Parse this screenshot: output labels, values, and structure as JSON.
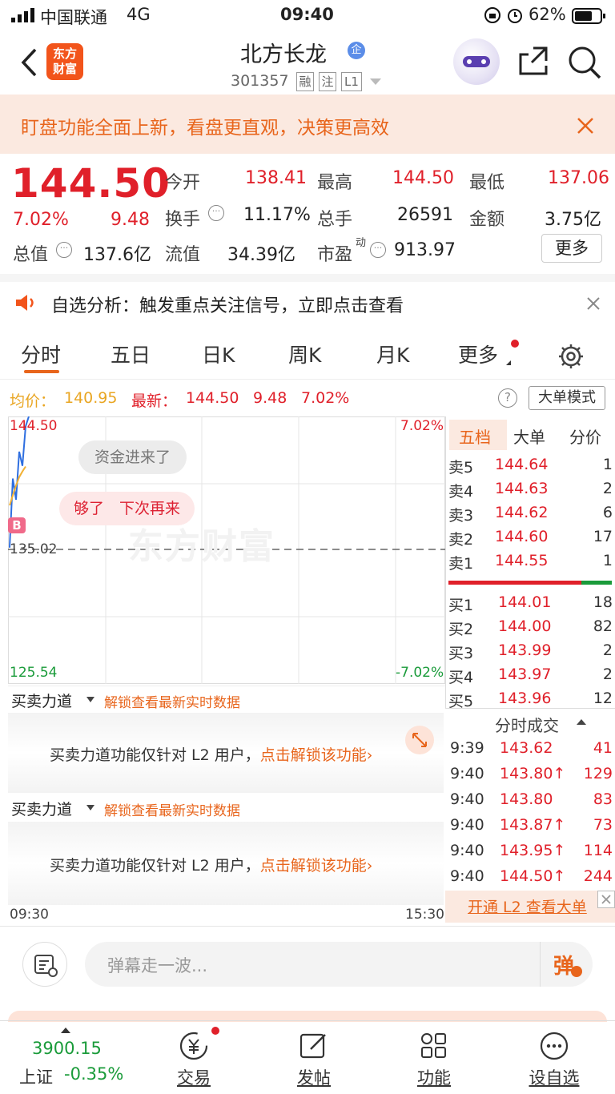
{
  "status_bar": {
    "carrier": "中国联通",
    "network": "4G",
    "time": "09:40",
    "battery": "62%"
  },
  "header": {
    "stock_name": "北方长龙",
    "badge": "企",
    "stock_code": "301357",
    "tags": [
      "融",
      "注",
      "L1"
    ],
    "logo_text": "东方财富"
  },
  "banner": {
    "text": "盯盘功能全面上新，看盘更直观，决策更高效"
  },
  "quote": {
    "price": "144.50",
    "change_pct": "7.02%",
    "change": "9.48",
    "open_label": "今开",
    "open": "138.41",
    "high_label": "最高",
    "high": "144.50",
    "low_label": "最低",
    "low": "137.06",
    "turnover_label": "换手",
    "turnover": "11.17%",
    "volume_label": "总手",
    "volume": "26591",
    "amount_label": "金额",
    "amount": "3.75亿",
    "mktcap_label": "总值",
    "mktcap": "137.6亿",
    "float_label": "流值",
    "float": "34.39亿",
    "pe_label": "市盈",
    "pe_sup": "动",
    "pe": "913.97",
    "more_button": "更多"
  },
  "alert": {
    "text": "自选分析：触发重点关注信号，立即点击查看"
  },
  "tabs": [
    "分时",
    "五日",
    "日K",
    "周K",
    "月K",
    "更多"
  ],
  "active_tab": "分时",
  "chart_info": {
    "avg_label": "均价：",
    "avg": "140.95",
    "latest_label": "最新：",
    "latest": "144.50",
    "change": "9.48",
    "change_pct": "7.02%",
    "mode_button": "大单模式"
  },
  "chart": {
    "top_price": "144.50",
    "top_pct": "7.02%",
    "mid_price": "135.02",
    "bottom_price": "125.54",
    "bottom_pct": "-7.02%",
    "start_time": "09:30",
    "end_time": "15:30",
    "bubble1": "资金进来了",
    "bubble2": "够了　下次再来",
    "watermark": "东方财富",
    "b_marker": "B"
  },
  "chart_data": {
    "type": "line",
    "title": "",
    "ylim": [
      125.54,
      144.5
    ],
    "series": [
      {
        "name": "",
        "values": [
          135.2,
          140.1,
          138.6,
          142.0,
          141.0,
          143.8,
          144.5
        ]
      },
      {
        "name": "",
        "values": [
          138.2,
          138.9,
          139.6,
          140.2,
          140.6,
          140.95
        ]
      }
    ]
  },
  "orderbook": {
    "tabs": [
      "五档",
      "大单",
      "分价"
    ],
    "asks": [
      {
        "label": "卖5",
        "price": "144.64",
        "vol": "1"
      },
      {
        "label": "卖4",
        "price": "144.63",
        "vol": "2"
      },
      {
        "label": "卖3",
        "price": "144.62",
        "vol": "6"
      },
      {
        "label": "卖2",
        "price": "144.60",
        "vol": "17"
      },
      {
        "label": "卖1",
        "price": "144.55",
        "vol": "1"
      }
    ],
    "bids": [
      {
        "label": "买1",
        "price": "144.01",
        "vol": "18"
      },
      {
        "label": "买2",
        "price": "144.00",
        "vol": "82"
      },
      {
        "label": "买3",
        "price": "143.99",
        "vol": "2"
      },
      {
        "label": "买4",
        "price": "143.97",
        "vol": "2"
      },
      {
        "label": "买5",
        "price": "143.96",
        "vol": "12"
      }
    ]
  },
  "trades": {
    "title": "分时成交",
    "rows": [
      {
        "time": "9:39",
        "price": "143.62",
        "vol": "41"
      },
      {
        "time": "9:40",
        "price": "143.80↑",
        "vol": "129"
      },
      {
        "time": "9:40",
        "price": "143.80",
        "vol": "83"
      },
      {
        "time": "9:40",
        "price": "143.87↑",
        "vol": "73"
      },
      {
        "time": "9:40",
        "price": "143.95↑",
        "vol": "114"
      },
      {
        "time": "9:40",
        "price": "144.50↑",
        "vol": "244"
      }
    ],
    "l2_link": "开通 L2 查看大单"
  },
  "force_panels": [
    {
      "dropdown": "买卖力道",
      "unlock_link": "解锁查看最新实时数据",
      "notice": "买卖力道功能仅针对 L2 用户，",
      "notice_link": "点击解锁该功能"
    },
    {
      "dropdown": "买卖力道",
      "unlock_link": "解锁查看最新实时数据",
      "notice": "买卖力道功能仅针对 L2 用户，",
      "notice_link": "点击解锁该功能"
    }
  ],
  "danmaku": {
    "placeholder": "弹幕走一波...",
    "button": "弹"
  },
  "bottom_nav": {
    "index_value": "3900.15",
    "index_name": "上证",
    "index_change": "-0.35%",
    "items": [
      "交易",
      "发帖",
      "功能",
      "设自选"
    ]
  }
}
